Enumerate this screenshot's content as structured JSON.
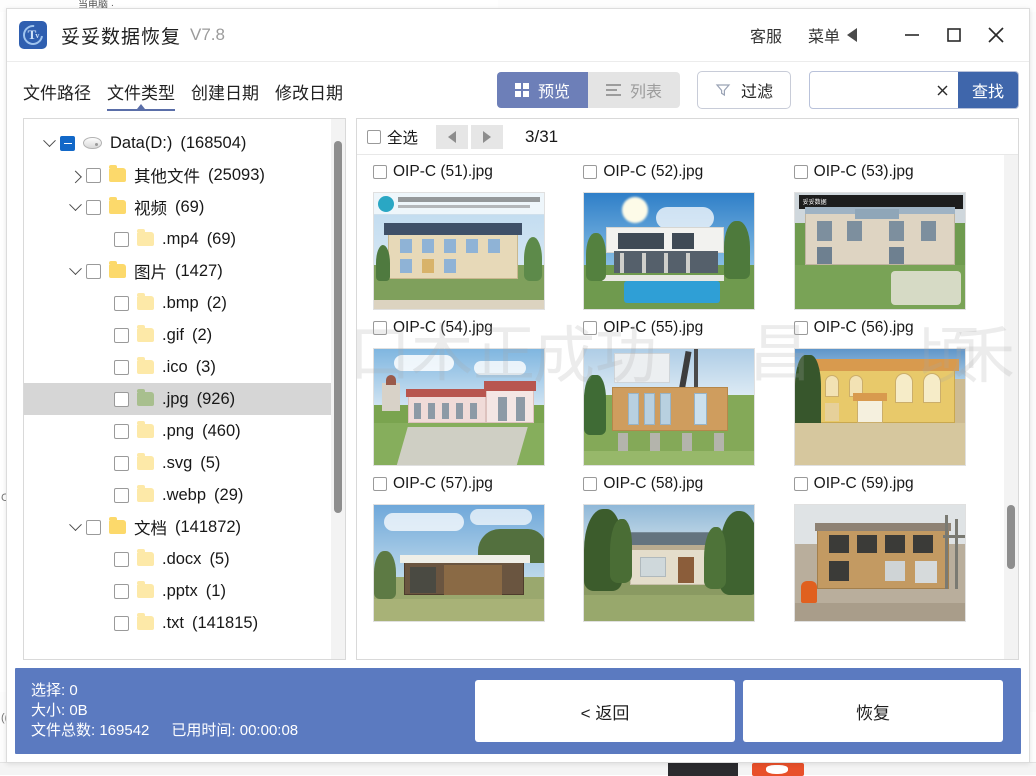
{
  "desktop": {
    "bg_window_title": "当电脑 ·",
    "bg_left_label": "C",
    "bg_left_label2": "((",
    "watermarks": [
      "口木正",
      "成功",
      "昌",
      "顷",
      "禾"
    ]
  },
  "titlebar": {
    "app_name": "妥妥数据恢复",
    "version": "V7.8",
    "support_label": "客服",
    "menu_label": "菜单",
    "minimize_icon": "minimize-icon",
    "maximize_icon": "maximize-icon",
    "close_icon": "close-icon",
    "logo_icon": "app-logo-icon"
  },
  "toolbar": {
    "tabs": [
      {
        "label": "文件路径",
        "active": false
      },
      {
        "label": "文件类型",
        "active": true
      },
      {
        "label": "创建日期",
        "active": false
      },
      {
        "label": "修改日期",
        "active": false
      }
    ],
    "view_preview": "预览",
    "view_list": "列表",
    "filter_label": "过滤",
    "search_value": "",
    "search_placeholder": "",
    "search_button": "查找",
    "accent_blue": "#3f66ab",
    "accent_muted": "#6d7fb8"
  },
  "tree": {
    "nodes": [
      {
        "indent": 0,
        "twist": "down",
        "check": "minus",
        "icon": "disk",
        "label": "Data(D:)",
        "count": "(168504)",
        "selected": false
      },
      {
        "indent": 1,
        "twist": "right",
        "check": "empty",
        "icon": "folder",
        "label": "其他文件",
        "count": "(25093)",
        "selected": false
      },
      {
        "indent": 1,
        "twist": "down",
        "check": "empty",
        "icon": "folder",
        "label": "视频",
        "count": "(69)",
        "selected": false
      },
      {
        "indent": 2,
        "twist": "none",
        "check": "empty",
        "icon": "folder-pale",
        "label": ".mp4",
        "count": "(69)",
        "selected": false
      },
      {
        "indent": 1,
        "twist": "down",
        "check": "empty",
        "icon": "folder",
        "label": "图片",
        "count": "(1427)",
        "selected": false
      },
      {
        "indent": 2,
        "twist": "none",
        "check": "empty",
        "icon": "folder-pale",
        "label": ".bmp",
        "count": "(2)",
        "selected": false
      },
      {
        "indent": 2,
        "twist": "none",
        "check": "empty",
        "icon": "folder-pale",
        "label": ".gif",
        "count": "(2)",
        "selected": false
      },
      {
        "indent": 2,
        "twist": "none",
        "check": "empty",
        "icon": "folder-pale",
        "label": ".ico",
        "count": "(3)",
        "selected": false
      },
      {
        "indent": 2,
        "twist": "none",
        "check": "empty",
        "icon": "folder-green",
        "label": ".jpg",
        "count": "(926)",
        "selected": true
      },
      {
        "indent": 2,
        "twist": "none",
        "check": "empty",
        "icon": "folder-pale",
        "label": ".png",
        "count": "(460)",
        "selected": false
      },
      {
        "indent": 2,
        "twist": "none",
        "check": "empty",
        "icon": "folder-pale",
        "label": ".svg",
        "count": "(5)",
        "selected": false
      },
      {
        "indent": 2,
        "twist": "none",
        "check": "empty",
        "icon": "folder-pale",
        "label": ".webp",
        "count": "(29)",
        "selected": false
      },
      {
        "indent": 1,
        "twist": "down",
        "check": "empty",
        "icon": "folder",
        "label": "文档",
        "count": "(141872)",
        "selected": false
      },
      {
        "indent": 2,
        "twist": "none",
        "check": "empty",
        "icon": "folder-pale",
        "label": ".docx",
        "count": "(5)",
        "selected": false
      },
      {
        "indent": 2,
        "twist": "none",
        "check": "empty",
        "icon": "folder-pale",
        "label": ".pptx",
        "count": "(1)",
        "selected": false
      },
      {
        "indent": 2,
        "twist": "none",
        "check": "empty",
        "icon": "folder-pale",
        "label": ".txt",
        "count": "(141815)",
        "selected": false
      }
    ]
  },
  "content": {
    "select_all_label": "全选",
    "prev_icon": "prev-page-icon",
    "next_icon": "next-page-icon",
    "page_indicator": "3/31",
    "files": [
      {
        "name": "OIP-C (51).jpg",
        "partial_top": true,
        "scene": "none"
      },
      {
        "name": "OIP-C (52).jpg",
        "partial_top": true,
        "scene": "none"
      },
      {
        "name": "OIP-C (53).jpg",
        "partial_top": true,
        "scene": "none"
      },
      {
        "name": "OIP-C (54).jpg",
        "partial_top": false,
        "scene": "render"
      },
      {
        "name": "OIP-C (55).jpg",
        "partial_top": false,
        "scene": "pool"
      },
      {
        "name": "OIP-C (56).jpg",
        "partial_top": false,
        "scene": "villa"
      },
      {
        "name": "OIP-C (57).jpg",
        "partial_top": false,
        "scene": "church"
      },
      {
        "name": "OIP-C (58).jpg",
        "partial_top": false,
        "scene": "crane"
      },
      {
        "name": "OIP-C (59).jpg",
        "partial_top": false,
        "scene": "yellow"
      },
      {
        "name": "",
        "partial_top": false,
        "scene": "garage"
      },
      {
        "name": "",
        "partial_top": false,
        "scene": "palms"
      },
      {
        "name": "",
        "partial_top": false,
        "scene": "site"
      }
    ]
  },
  "footer": {
    "selected_label": "选择:",
    "selected_value": "0",
    "size_label": "大小:",
    "size_value": "0B",
    "total_label": "文件总数:",
    "total_value": "169542",
    "elapsed_label": "已用时间:",
    "elapsed_value": "00:00:08",
    "back_button": "< 返回",
    "recover_button": "恢复",
    "bar_color": "#5b7ac0"
  }
}
